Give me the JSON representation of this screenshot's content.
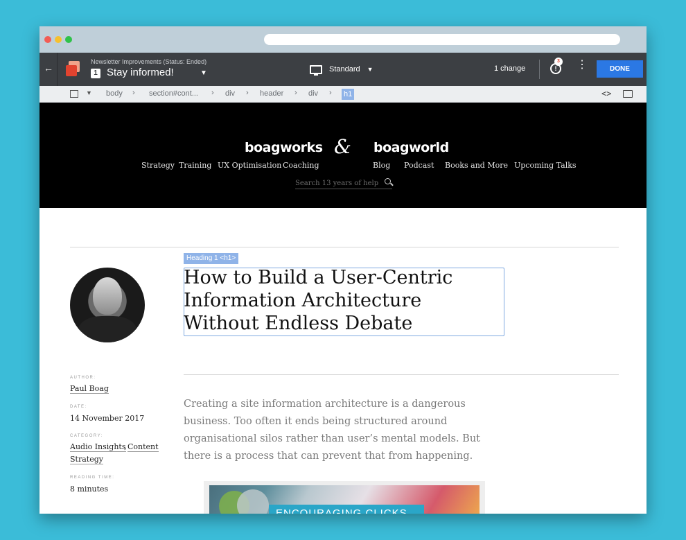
{
  "editor": {
    "experiment_name": "Newsletter Improvements (Status: Ended)",
    "variation_number": "1",
    "variation_name": "Stay informed!",
    "device_label": "Standard",
    "changes_label": "1 change",
    "notification_count": "3",
    "notification_glyph": "!",
    "done_label": "DONE",
    "breadcrumb": [
      "body",
      "section#cont...",
      "div",
      "header",
      "div",
      "h1"
    ],
    "code_icon_glyph": "<>"
  },
  "site": {
    "brand_left": "boagworks",
    "ampersand": "&",
    "brand_right": "boagworld",
    "nav_left": [
      "Strategy",
      "Training",
      "UX Optimisation",
      "Coaching"
    ],
    "nav_right": [
      "Blog",
      "Podcast",
      "Books and More",
      "Upcoming Talks"
    ],
    "search_placeholder": "Search 13 years of help"
  },
  "article": {
    "element_tag": "Heading 1 <h1>",
    "title": "How to Build a User-Centric Information Architecture Without Endless Debate",
    "meta": {
      "author_label": "AUTHOR:",
      "author": "Paul Boag",
      "date_label": "DATE:",
      "date": "14 November 2017",
      "category_label": "CATEGORY:",
      "category_1": "Audio Insights",
      "category_sep": ",",
      "category_2a": "Content",
      "category_2b": "Strategy",
      "reading_label": "READING TIME:",
      "reading_time": "8 minutes"
    },
    "intro": "Creating a site information architecture is a dangerous business. Too often it ends being structured around organisational silos rather than user’s mental models. But there is a process that can prevent that from happening.",
    "hero_banner": "ENCOURAGING CLICKS"
  }
}
